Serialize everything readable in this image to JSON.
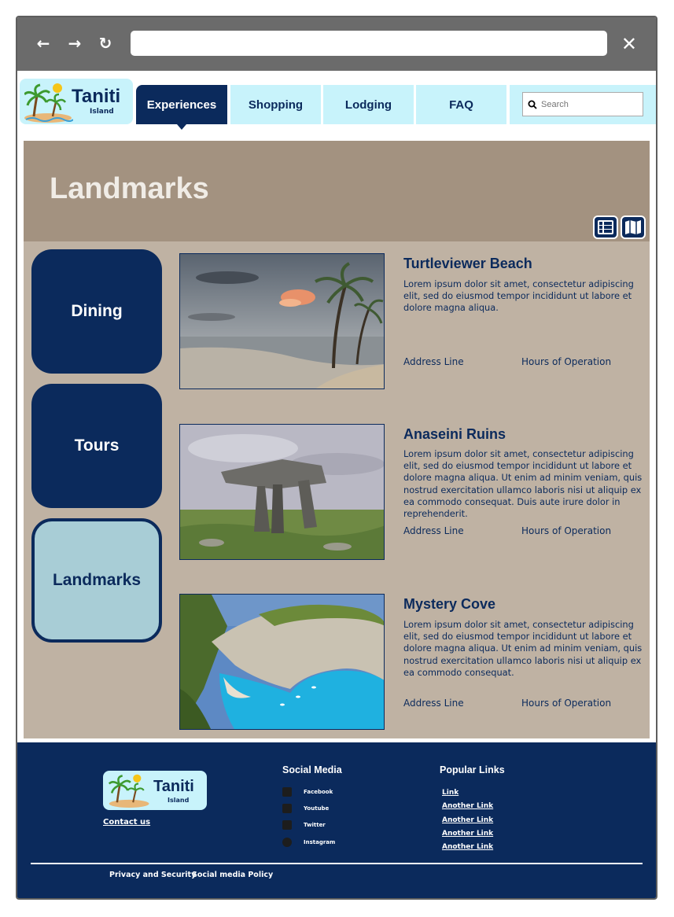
{
  "browser": {
    "back": "←",
    "forward": "→",
    "reload": "↻",
    "close": "✕",
    "url": ""
  },
  "header": {
    "logo_text": "Taniti",
    "logo_sub": "Island",
    "tabs": [
      {
        "label": "Experiences",
        "active": true
      },
      {
        "label": "Shopping",
        "active": false
      },
      {
        "label": "Lodging",
        "active": false
      },
      {
        "label": "FAQ",
        "active": false
      }
    ],
    "search_placeholder": "Search"
  },
  "hero": {
    "title": "Landmarks",
    "views": [
      "list-view-icon",
      "map-view-icon"
    ]
  },
  "categories": [
    {
      "label": "Dining",
      "selected": false
    },
    {
      "label": "Tours",
      "selected": false
    },
    {
      "label": "Landmarks",
      "selected": true
    }
  ],
  "cards": [
    {
      "title": "Turtleviewer Beach",
      "description": "Lorem ipsum dolor sit amet, consectetur adipiscing elit, sed do eiusmod tempor incididunt ut labore et dolore magna aliqua.",
      "address": "Address Line",
      "hours": "Hours of Operation",
      "image": "beach-sunset-photo"
    },
    {
      "title": "Anaseini Ruins",
      "description": "Lorem ipsum dolor sit amet, consectetur adipiscing elit, sed do eiusmod tempor incididunt ut labore et dolore magna aliqua. Ut enim ad minim veniam, quis nostrud exercitation ullamco laboris nisi ut aliquip ex ea commodo consequat. Duis aute irure dolor in reprehenderit.",
      "address": "Address Line",
      "hours": "Hours of Operation",
      "image": "stone-dolmen-photo"
    },
    {
      "title": "Mystery Cove",
      "description": "Lorem ipsum dolor sit amet, consectetur adipiscing elit, sed do eiusmod tempor incididunt ut labore et dolore magna aliqua. Ut enim ad minim veniam, quis nostrud exercitation ullamco laboris nisi ut aliquip ex ea commodo consequat.",
      "address": "Address Line",
      "hours": "Hours of Operation",
      "image": "cove-cliff-photo"
    }
  ],
  "footer": {
    "logo_text": "Taniti",
    "logo_sub": "Island",
    "contact": "Contact us",
    "social_heading": "Social Media",
    "social": [
      "Facebook",
      "Youtube",
      "Twitter",
      "Instagram"
    ],
    "links_heading": "Popular Links",
    "links": [
      "Link",
      "Another Link",
      "Another Link",
      "Another Link",
      "Another Link"
    ],
    "privacy": "Privacy and Security",
    "policy": "Social media Policy"
  },
  "colors": {
    "navy": "#0b2a5c",
    "light_cyan": "#c8f3fb",
    "hero_brown": "#a39280",
    "content_tan": "#bfb2a3",
    "selected_teal": "#a8cdd6"
  }
}
